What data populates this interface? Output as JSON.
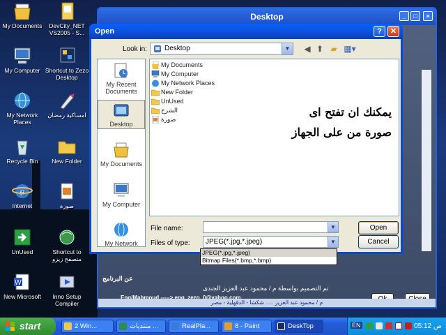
{
  "desktop_icons": [
    {
      "label": "My Documents",
      "icon": "my-documents-icon"
    },
    {
      "label": "DevCity_NET VS2005 - S...",
      "icon": "document-icon"
    },
    {
      "label": "My Computer",
      "icon": "computer-icon"
    },
    {
      "label": "Shortcut to Zezo Desktop",
      "icon": "app-icon"
    },
    {
      "label": "My Network Places",
      "icon": "network-icon"
    },
    {
      "label": "امساكية رمضان",
      "icon": "pen-icon"
    },
    {
      "label": "Recycle Bin",
      "icon": "recycle-bin-icon"
    },
    {
      "label": "New Folder",
      "icon": "folder-icon"
    },
    {
      "label": "Internet",
      "icon": "internet-explorer-icon"
    },
    {
      "label": "صورة",
      "icon": "image-icon"
    },
    {
      "label": "UnUsed",
      "icon": "green-arrow-icon"
    },
    {
      "label": "Shortcut to متصفح زيزو",
      "icon": "globe-icon"
    },
    {
      "label": "New Microsoft",
      "icon": "word-icon"
    },
    {
      "label": "Inno Setup Compiler",
      "icon": "setup-icon"
    }
  ],
  "bg_window": {
    "title": "Desktop",
    "credit_line": "تم التصميم بواسطة م / محمود عبد العزيز الجندى",
    "email_line": "Eng/Mahmoud -----> eng_zezo_0@yahoo.com",
    "section_label": "عن البرنامج",
    "footer": "م / محمود عبد العزيز ..... شكشا - الدقهلية - مصر",
    "ok": "Ok",
    "close": "Close"
  },
  "dialog": {
    "title": "Open",
    "look_in_label": "Look in:",
    "look_in_value": "Desktop",
    "places": [
      {
        "label": "My Recent Documents",
        "selected": false
      },
      {
        "label": "Desktop",
        "selected": true
      },
      {
        "label": "My Documents",
        "selected": false
      },
      {
        "label": "My Computer",
        "selected": false
      },
      {
        "label": "My Network",
        "selected": false
      }
    ],
    "files": [
      {
        "name": "My Documents",
        "icon": "my-documents-icon"
      },
      {
        "name": "My Computer",
        "icon": "computer-icon"
      },
      {
        "name": "My Network Places",
        "icon": "network-icon"
      },
      {
        "name": "New Folder",
        "icon": "folder-icon"
      },
      {
        "name": "UnUsed",
        "icon": "folder-icon"
      },
      {
        "name": "الشرح",
        "icon": "folder-icon"
      },
      {
        "name": "صورة",
        "icon": "image-icon"
      }
    ],
    "note_line1": "يمكنك ان تفتح اى",
    "note_line2": "صورة من على الجهاز",
    "file_name_label": "File name:",
    "file_name_value": "",
    "files_of_type_label": "Files of type:",
    "files_of_type_value": "JPEG(*.jpg,*.jpeg)",
    "type_options": [
      "JPEG(*.jpg,*.jpeg)",
      "Bitmap Files(*.bmp,*.bmp)"
    ],
    "open": "Open",
    "cancel": "Cancel"
  },
  "taskbar": {
    "start": "start",
    "tasks": [
      {
        "label": "2 Win...",
        "color": "#f2c94c"
      },
      {
        "label": "منتديات ...",
        "color": "#2e8b57"
      },
      {
        "label": "RealPla...",
        "color": "#3a7bd5"
      },
      {
        "label": "8 - Paint",
        "color": "#e0a030"
      },
      {
        "label": "DeskTop",
        "color": "#ffffff"
      }
    ],
    "lang": "EN",
    "time": "05:12",
    "ampm": "ص"
  }
}
